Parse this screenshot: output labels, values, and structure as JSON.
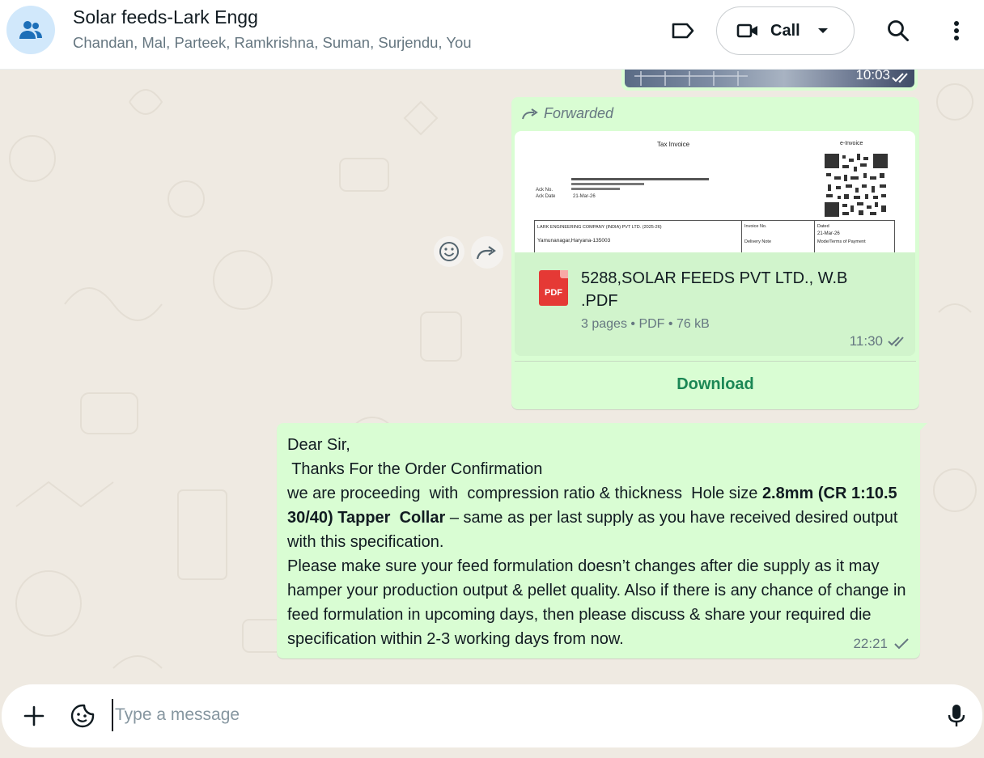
{
  "header": {
    "title": "Solar feeds-Lark Engg",
    "subtitle": "Chandan, Mal, Parteek, Ramkrishna, Suman, Surjendu, You",
    "call_label": "Call",
    "icons": [
      "group-icon",
      "label-icon",
      "video-icon",
      "chevron-down-icon",
      "search-icon",
      "more-vert-icon"
    ]
  },
  "messages": {
    "image": {
      "time": "10:03"
    },
    "forwarded": {
      "label": "Forwarded",
      "preview": {
        "title": "Tax Invoice",
        "right_title": "e-Invoice",
        "ack_no_label": "Ack No.",
        "ack_date_label": "Ack Date",
        "ack_date": "21-Mar-26",
        "company": "LARK ENGINEERING COMPANY (INDIA) PVT LTD. (2025-26)",
        "address": "Yamunanagar,Haryana-135003",
        "invoice_label": "Invoice No.",
        "dated_label": "Dated",
        "dated": "21-Mar-26",
        "delivery_label": "Delivery Note",
        "terms_label": "Mode/Terms of Payment"
      },
      "file_name": "5288,SOLAR FEEDS PVT LTD., W.B .PDF",
      "file_badge": "PDF",
      "pages": "3 pages",
      "type": "PDF",
      "size": "76 kB",
      "time": "11:30",
      "download_label": "Download"
    },
    "text": {
      "line1": "Dear Sir,",
      "line2": " Thanks For the Order Confirmation",
      "line3a": "we are proceeding  with  compression ratio & thickness  Hole size ",
      "line3b": "2.8mm (CR 1:10.5 30/40) Tapper  Collar",
      "line3c": " – same as per last supply as you have received desired output with this specification.",
      "line4": "Please make sure your feed formulation doesn’t changes after die supply as it may hamper your production output & pellet quality. Also if there is any chance of change in feed formulation in upcoming days, then please discuss & share your required die specification within 2-3 working days from now.",
      "time": "22:21"
    }
  },
  "composer": {
    "placeholder": "Type a message"
  },
  "colors": {
    "outgoing_bubble": "#d9fdd3",
    "chat_bg": "#efeae2",
    "download_green": "#1b8755",
    "pdf_red": "#e53935"
  }
}
